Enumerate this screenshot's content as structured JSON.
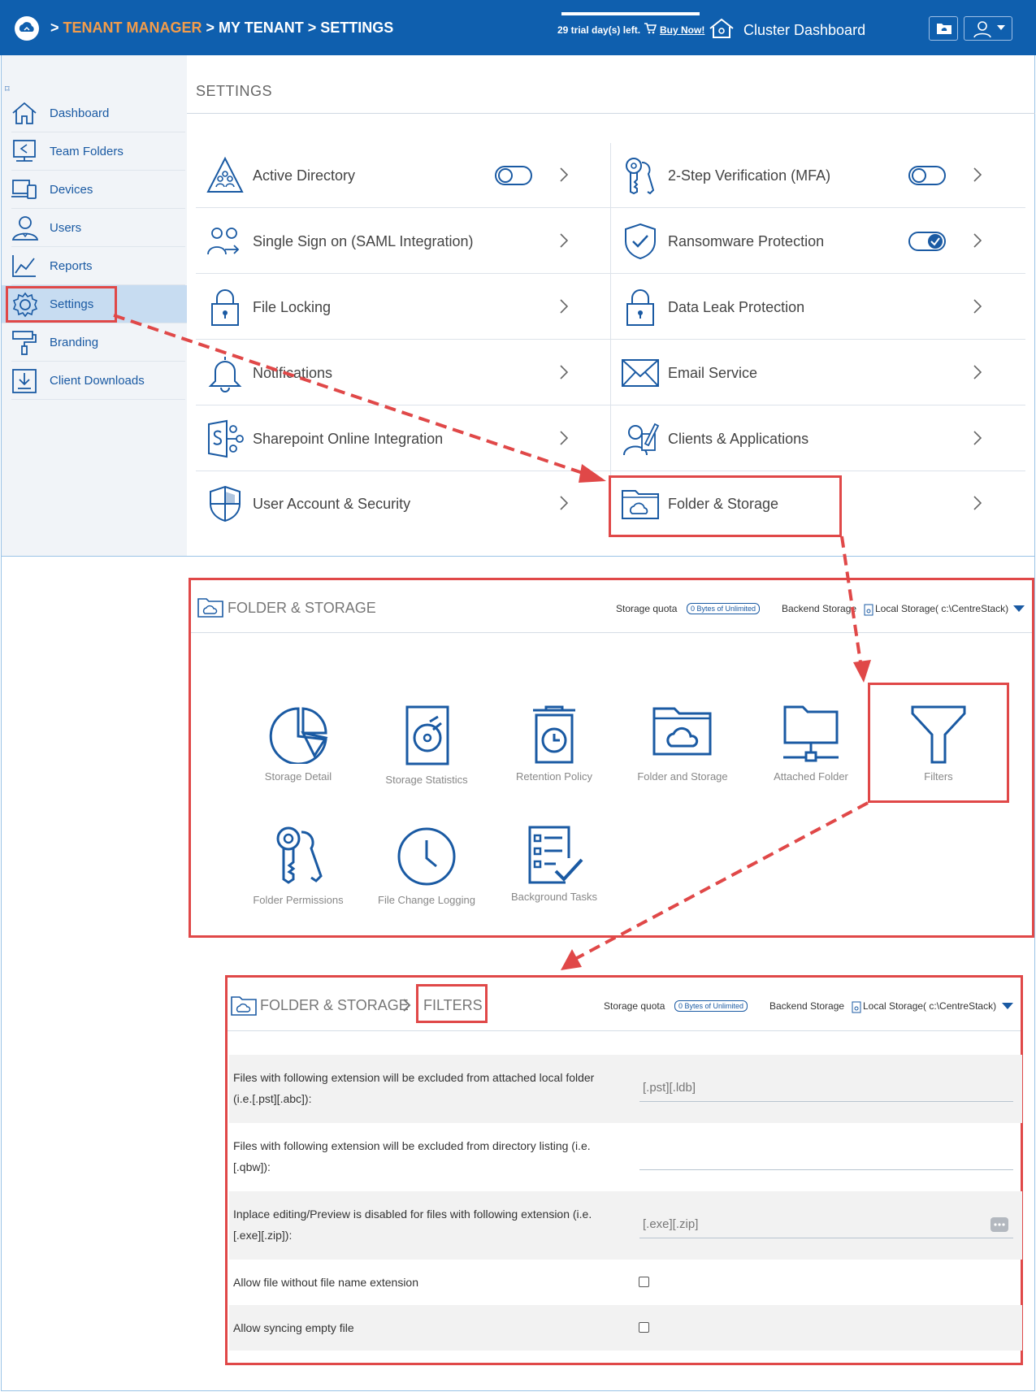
{
  "header": {
    "breadcrumb": [
      ">",
      "TENANT MANAGER",
      "> MY TENANT",
      "> SETTINGS"
    ],
    "trial_text": "29 trial day(s) left.",
    "buy_now": "Buy Now!",
    "cluster_dashboard": "Cluster Dashboard"
  },
  "sidebar": {
    "items": [
      {
        "label": "Dashboard",
        "icon": "home-icon"
      },
      {
        "label": "Team Folders",
        "icon": "team-folders-icon"
      },
      {
        "label": "Devices",
        "icon": "devices-icon"
      },
      {
        "label": "Users",
        "icon": "user-icon"
      },
      {
        "label": "Reports",
        "icon": "chart-icon"
      },
      {
        "label": "Settings",
        "icon": "gear-icon"
      },
      {
        "label": "Branding",
        "icon": "paint-roller-icon"
      },
      {
        "label": "Client Downloads",
        "icon": "download-icon"
      }
    ],
    "active": "Settings"
  },
  "settings": {
    "title": "SETTINGS",
    "left": [
      {
        "label": "Active Directory",
        "toggle": "off"
      },
      {
        "label": "Single Sign on (SAML Integration)"
      },
      {
        "label": "File Locking"
      },
      {
        "label": "Notifications"
      },
      {
        "label": "Sharepoint Online Integration"
      },
      {
        "label": "User Account & Security"
      }
    ],
    "right": [
      {
        "label": "2-Step Verification (MFA)",
        "toggle": "off"
      },
      {
        "label": "Ransomware Protection",
        "toggle": "on"
      },
      {
        "label": "Data Leak Protection"
      },
      {
        "label": "Email Service"
      },
      {
        "label": "Clients & Applications"
      },
      {
        "label": "Folder & Storage"
      }
    ]
  },
  "folder_storage": {
    "title": "FOLDER & STORAGE",
    "storage_quota_label": "Storage quota",
    "storage_quota_value": "0 Bytes of Unlimited",
    "backend_label": "Backend Storage",
    "backend_value": "Local Storage( c:\\CentreStack)",
    "tiles": [
      {
        "label": "Storage Detail"
      },
      {
        "label": "Storage Statistics"
      },
      {
        "label": "Retention Policy"
      },
      {
        "label": "Folder and Storage"
      },
      {
        "label": "Attached Folder"
      },
      {
        "label": "Filters"
      },
      {
        "label": "Folder Permissions"
      },
      {
        "label": "File Change Logging"
      },
      {
        "label": "Background Tasks"
      }
    ]
  },
  "filters": {
    "crumb_parent": "FOLDER & STORAGE",
    "crumb_current": "FILTERS",
    "storage_quota_label": "Storage quota",
    "storage_quota_value": "0 Bytes of Unlimited",
    "backend_label": "Backend Storage",
    "backend_value": "Local Storage( c:\\CentreStack)",
    "rows": [
      {
        "label": "Files with following extension will be excluded from attached local folder (i.e.[.pst][.abc]):",
        "value": "[.pst][.ldb]"
      },
      {
        "label": "Files with following extension will be excluded from directory listing (i.e. [.qbw]):",
        "value": ""
      },
      {
        "label": "Inplace editing/Preview is disabled for files with following extension (i.e. [.exe][.zip]):",
        "value": "[.exe][.zip]"
      },
      {
        "label": "Allow file without file name extension",
        "checked": false
      },
      {
        "label": "Allow syncing empty file",
        "checked": false
      }
    ]
  },
  "colors": {
    "header_bg": "#0f5fae",
    "accent": "#1a5aa3",
    "breadcrumb_highlight": "#f39c4a",
    "annotation": "#e04848"
  }
}
